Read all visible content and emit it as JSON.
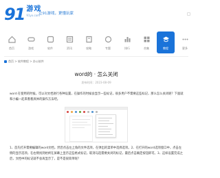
{
  "header": {
    "logo_number": "91",
    "logo_game_cn": "游戏",
    "logo_game_en": "91yx.com",
    "slogan": "让91游戏，更懂玩家"
  },
  "nav": {
    "items": [
      {
        "label": "首页",
        "icon": "home-icon"
      },
      {
        "label": "游戏",
        "icon": "game-icon"
      },
      {
        "label": "软件",
        "icon": "software-icon"
      },
      {
        "label": "资讯",
        "icon": "news-icon"
      },
      {
        "label": "攻略",
        "icon": "guide-icon"
      },
      {
        "label": "专题",
        "icon": "topic-icon"
      },
      {
        "label": "排行",
        "icon": "rank-icon"
      },
      {
        "label": "合集",
        "icon": "collection-icon"
      },
      {
        "label": "教程",
        "icon": "tutorial-icon",
        "active": true
      },
      {
        "label": "更多",
        "icon": "more-icon"
      }
    ],
    "accent_color": "#1a73d9"
  },
  "breadcrumb": {
    "text": "首页 > 软件教程 > 办公软件"
  },
  "article": {
    "title": "word的 · 怎么关闭",
    "meta": "发布时间：2023-08-09",
    "paragraph1": "word 在使用的时候，可以对文档进行各种设置，在操作的时候会显示一些标记，很多用户不需要这些标记，那么怎么关闭呢？下面就和小编一起来看看具体的操作方法吧。",
    "paragraph2": "1、首先打开需要编辑的word文档，然后点击左上角的文件选项，在弹出的菜单中选择选项。2、在打开的word选项窗口中，点击左侧的显示选项，在右侧找到始终在屏幕上显示这些格式标记，取消勾选需要关闭的标记，最后点击确定按钮即可。3、这样设置完成之后，文档中的标记就不会再显示了，是不是很简单呢？"
  }
}
